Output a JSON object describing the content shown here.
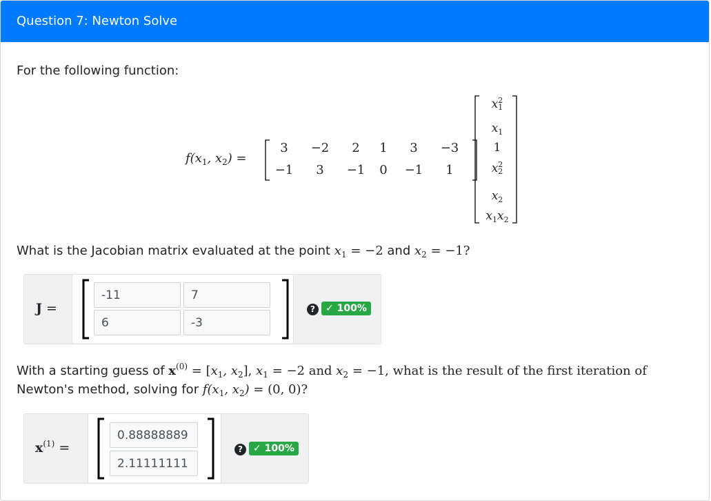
{
  "header": {
    "title": "Question 7: Newton Solve"
  },
  "intro": "For the following function:",
  "function": {
    "lhs": "f(x1, x2) =",
    "matrix_rows": [
      [
        "3",
        "−2",
        "2",
        "1",
        "3",
        "−3"
      ],
      [
        "−1",
        "3",
        "−1",
        "0",
        "−1",
        "1"
      ]
    ],
    "vector": [
      "x1²",
      "x1",
      "1",
      "x2²",
      "x2",
      "x1x2"
    ]
  },
  "part1": {
    "prompt_prefix": "What is the Jacobian matrix evaluated at the point",
    "prompt_mid": "and",
    "x1_val": "= −2",
    "x2_val": "= −1?",
    "label": "J =",
    "inputs": [
      [
        "-11",
        "7"
      ],
      [
        "6",
        "-3"
      ]
    ],
    "score": "✓ 100%",
    "help_icon": "question-circle-icon"
  },
  "part2": {
    "line1_prefix": "With a starting guess of",
    "line1_eq": "= [x1, x2],",
    "line1_x1": "= −2 and",
    "line1_x2": "= −1, what is the result of the first iteration of",
    "line2_prefix": "Newton's method, solving for",
    "line2_eq": "f(x1, x2) = (0, 0)?",
    "label": "x(1) =",
    "inputs": [
      "0.88888889",
      "2.11111111"
    ],
    "score": "✓ 100%",
    "help_icon": "question-circle-icon"
  },
  "colors": {
    "header": "#007bff",
    "success": "#28a745",
    "panel": "#f0f1f2"
  }
}
